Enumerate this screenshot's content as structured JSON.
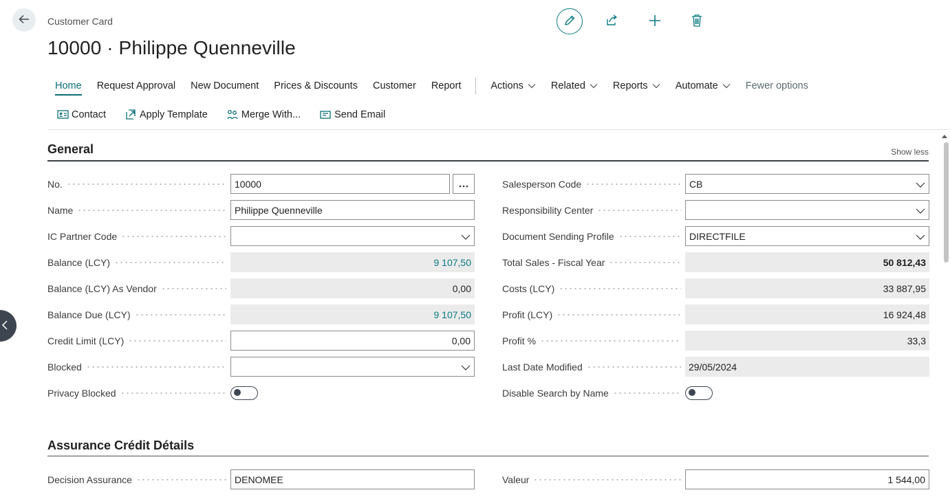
{
  "header": {
    "breadcrumb": "Customer Card",
    "title": "10000 · Philippe Quenneville"
  },
  "icons": {
    "back": "arrow-left-icon",
    "edit": "pencil-icon",
    "share": "share-icon",
    "new": "plus-icon",
    "delete": "trash-icon"
  },
  "colors": {
    "accent": "#0a7a82",
    "dark": "#3d4550",
    "readonly_bg": "#ebebeb"
  },
  "menu": {
    "items": [
      "Home",
      "Request Approval",
      "New Document",
      "Prices & Discounts",
      "Customer",
      "Report"
    ],
    "dropdowns": [
      "Actions",
      "Related",
      "Reports",
      "Automate"
    ],
    "fewer_options": "Fewer options"
  },
  "subactions": [
    "Contact",
    "Apply Template",
    "Merge With...",
    "Send Email"
  ],
  "general": {
    "title": "General",
    "show_less": "Show less",
    "left": [
      {
        "label": "No.",
        "value": "10000"
      },
      {
        "label": "Name",
        "value": "Philippe Quenneville"
      },
      {
        "label": "IC Partner Code",
        "value": ""
      },
      {
        "label": "Balance (LCY)",
        "value": "9 107,50"
      },
      {
        "label": "Balance (LCY) As Vendor",
        "value": "0,00"
      },
      {
        "label": "Balance Due (LCY)",
        "value": "9 107,50"
      },
      {
        "label": "Credit Limit (LCY)",
        "value": "0,00"
      },
      {
        "label": "Blocked",
        "value": ""
      },
      {
        "label": "Privacy Blocked",
        "value": "off"
      }
    ],
    "right": [
      {
        "label": "Salesperson Code",
        "value": "CB"
      },
      {
        "label": "Responsibility Center",
        "value": ""
      },
      {
        "label": "Document Sending Profile",
        "value": "DIRECTFILE"
      },
      {
        "label": "Total Sales - Fiscal Year",
        "value": "50 812,43"
      },
      {
        "label": "Costs (LCY)",
        "value": "33 887,95"
      },
      {
        "label": "Profit (LCY)",
        "value": "16 924,48"
      },
      {
        "label": "Profit %",
        "value": "33,3"
      },
      {
        "label": "Last Date Modified",
        "value": "29/05/2024"
      },
      {
        "label": "Disable Search by Name",
        "value": "off"
      }
    ]
  },
  "assurance": {
    "title": "Assurance Crédit Détails",
    "left": [
      {
        "label": "Decision Assurance",
        "value": "DENOMEE"
      }
    ],
    "right": [
      {
        "label": "Valeur",
        "value": "1 544,00"
      }
    ]
  }
}
